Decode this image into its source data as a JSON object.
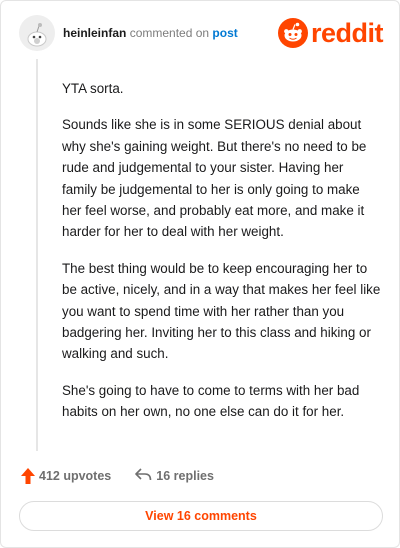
{
  "comment": {
    "author": "heinleinfan",
    "verb": "commented on",
    "target": "post",
    "paragraphs": [
      "YTA sorta.",
      "Sounds like she is in some SERIOUS denial about why she's gaining weight. But there's no need to be rude and judgemental to your sister. Having her family be judgemental to her is only going to make her feel worse, and probably eat more, and make it harder for her to deal with her weight.",
      "The best thing would be to keep encouraging her to be active, nicely, and in a way that makes her feel like you want to spend time with her rather than you badgering her. Inviting her to this class and hiking or walking and such.",
      "She's going to have to come to terms with her bad habits on her own, no one else can do it for her."
    ]
  },
  "brand": {
    "wordmark": "reddit",
    "color": "#ff4500"
  },
  "stats": {
    "upvotes": "412 upvotes",
    "replies": "16 replies"
  },
  "footer": {
    "view_label": "View 16 comments"
  },
  "icons": {
    "upvote": "upvote-arrow-icon",
    "reply": "reply-arrow-icon",
    "avatar": "snoo-avatar-icon",
    "logo": "reddit-snoo-icon"
  }
}
